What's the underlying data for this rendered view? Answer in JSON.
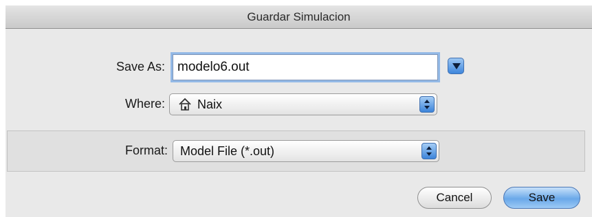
{
  "dialog": {
    "title": "Guardar Simulacion"
  },
  "save_as": {
    "label": "Save As:",
    "value": "modelo6.out"
  },
  "where": {
    "label": "Where:",
    "value": "Naix",
    "icon": "home-icon"
  },
  "format": {
    "label": "Format:",
    "value": "Model File (*.out)"
  },
  "buttons": {
    "cancel_label": "Cancel",
    "save_label": "Save"
  },
  "colors": {
    "accent": "#3e86dc",
    "focus_ring": "#93b9e6"
  }
}
